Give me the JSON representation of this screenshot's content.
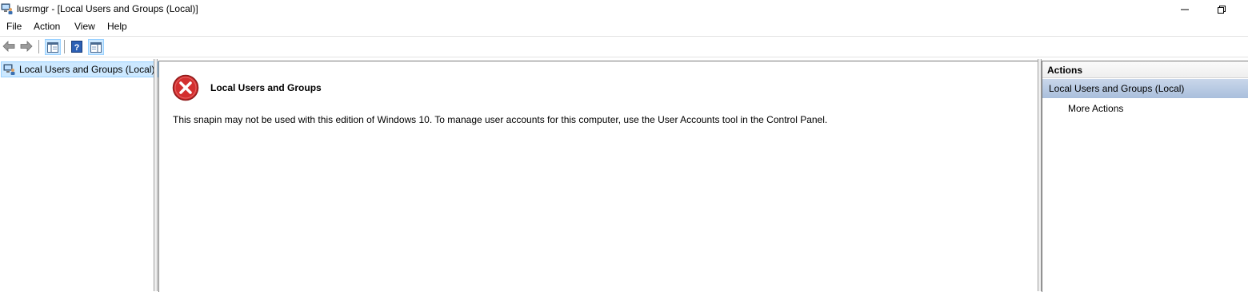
{
  "window": {
    "title": "lusrmgr - [Local Users and Groups (Local)]",
    "icon": "computer-users-icon"
  },
  "menu": {
    "items": [
      "File",
      "Action",
      "View",
      "Help"
    ]
  },
  "toolbar": {
    "buttons": [
      "back-arrow-icon",
      "forward-arrow-icon",
      "show-hide-console-tree-icon",
      "help-icon",
      "show-hide-action-pane-icon"
    ]
  },
  "tree": {
    "root_label": "Local Users and Groups (Local)"
  },
  "content": {
    "error_title": "Local Users and Groups",
    "error_message": "This snapin may not be used with this edition of Windows 10. To manage user accounts for this computer, use the User Accounts tool in the Control Panel."
  },
  "actions": {
    "header": "Actions",
    "section_label": "Local Users and Groups (Local)",
    "more_actions": "More Actions"
  },
  "colors": {
    "selection": "#cce8ff",
    "section_header": "#b8cbe4",
    "error_red": "#d32f2f"
  }
}
